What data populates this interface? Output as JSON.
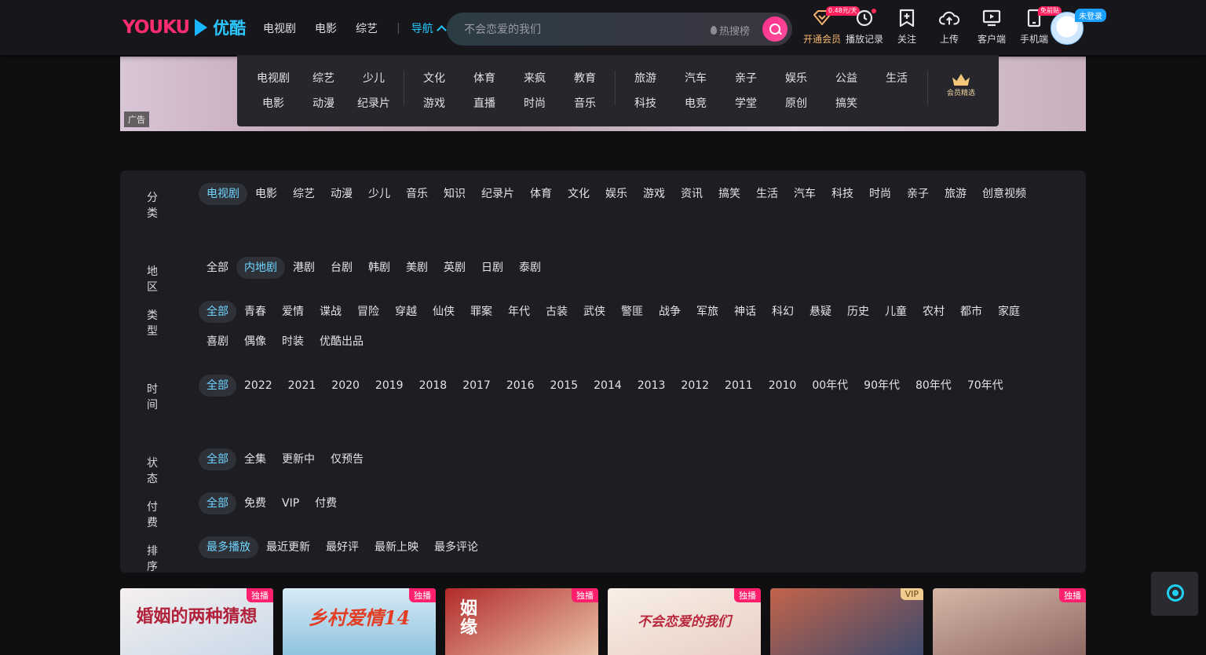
{
  "header": {
    "logo_text": "YOUKU",
    "logo_cn": "优酷",
    "nav": [
      "电视剧",
      "电影",
      "综艺"
    ],
    "nav_separator": "|",
    "nav_active": "导航",
    "search": {
      "placeholder": "不会恋爱的我们",
      "hot_label": "热搜榜"
    },
    "tools": [
      {
        "label": "开通会员",
        "icon": "diamond-icon",
        "tag": "0.48元/天",
        "vip": true
      },
      {
        "label": "播放记录",
        "icon": "clock-icon",
        "dot": true
      },
      {
        "label": "关注",
        "icon": "bookmark-plus-icon"
      },
      {
        "label": "上传",
        "icon": "cloud-upload-icon"
      },
      {
        "label": "客户端",
        "icon": "monitor-icon"
      },
      {
        "label": "手机端",
        "icon": "phone-icon",
        "tag": "免前贴"
      }
    ],
    "login_tag": "未登录"
  },
  "banner": {
    "ad_label": "广告"
  },
  "nav_dropdown": {
    "groups": [
      [
        "电视剧",
        "电影",
        "综艺",
        "动漫",
        "少儿",
        "纪录片"
      ],
      [
        "文化",
        "游戏",
        "体育",
        "直播",
        "来疯",
        "时尚",
        "教育",
        "音乐"
      ],
      [
        "旅游",
        "科技",
        "汽车",
        "电竞",
        "亲子",
        "学堂",
        "娱乐",
        "原创",
        "公益",
        "搞笑",
        "生活"
      ]
    ],
    "vip_label": "会员精选"
  },
  "filters": [
    {
      "label": "分类",
      "active": 0,
      "options": [
        "电视剧",
        "电影",
        "综艺",
        "动漫",
        "少儿",
        "音乐",
        "知识",
        "纪录片",
        "体育",
        "文化",
        "娱乐",
        "游戏",
        "资讯",
        "搞笑",
        "生活",
        "汽车",
        "科技",
        "时尚",
        "亲子",
        "旅游",
        "创意视频"
      ]
    },
    {
      "label": "地区",
      "active": 1,
      "options": [
        "全部",
        "内地剧",
        "港剧",
        "台剧",
        "韩剧",
        "美剧",
        "英剧",
        "日剧",
        "泰剧"
      ]
    },
    {
      "label": "类型",
      "active": 0,
      "options": [
        "全部",
        "青春",
        "爱情",
        "谍战",
        "冒险",
        "穿越",
        "仙侠",
        "罪案",
        "年代",
        "古装",
        "武侠",
        "警匪",
        "战争",
        "军旅",
        "神话",
        "科幻",
        "悬疑",
        "历史",
        "儿童",
        "农村",
        "都市",
        "家庭",
        "喜剧",
        "偶像",
        "时装",
        "优酷出品"
      ]
    },
    {
      "label": "时间",
      "active": 0,
      "options": [
        "全部",
        "2022",
        "2021",
        "2020",
        "2019",
        "2018",
        "2017",
        "2016",
        "2015",
        "2014",
        "2013",
        "2012",
        "2011",
        "2010",
        "00年代",
        "90年代",
        "80年代",
        "70年代"
      ]
    },
    {
      "label": "状态",
      "active": 0,
      "options": [
        "全部",
        "全集",
        "更新中",
        "仅预告"
      ]
    },
    {
      "label": "付费",
      "active": 0,
      "options": [
        "全部",
        "免费",
        "VIP",
        "付费"
      ]
    },
    {
      "label": "排序",
      "active": 0,
      "options": [
        "最多播放",
        "最近更新",
        "最好评",
        "最新上映",
        "最多评论"
      ]
    }
  ],
  "cards": [
    {
      "badge": "独播",
      "title": "婚姻的两种猜想"
    },
    {
      "badge": "独播",
      "title": "乡村爱情14"
    },
    {
      "badge": "独播",
      "title": "姻缘"
    },
    {
      "badge": "独播",
      "title": "不会恋爱的我们"
    },
    {
      "badge": "VIP",
      "title": ""
    },
    {
      "badge": "独播",
      "title": ""
    }
  ]
}
